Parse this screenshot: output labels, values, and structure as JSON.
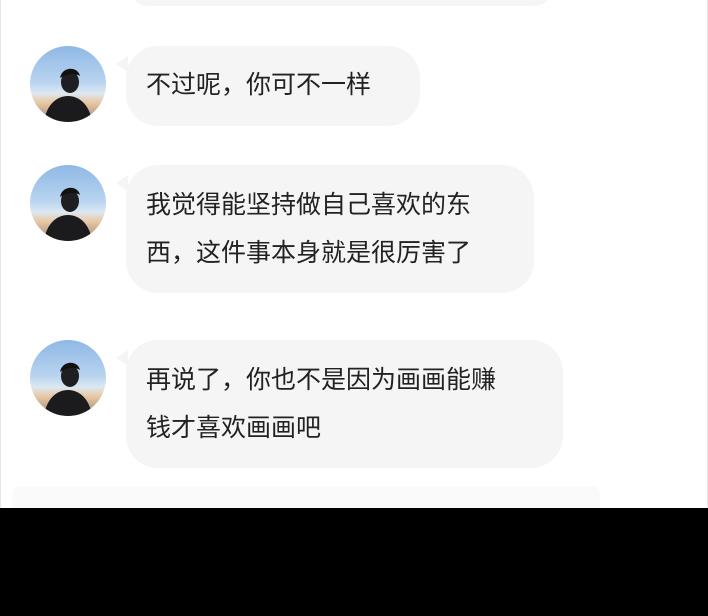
{
  "messages": [
    {
      "lines": [
        "不过呢，你可不一样"
      ]
    },
    {
      "lines": [
        "我觉得能坚持做自己喜欢的东",
        "西，这件事本身就是很厉害了"
      ]
    },
    {
      "lines": [
        "再说了，你也不是因为画画能赚",
        "钱才喜欢画画吧"
      ]
    }
  ]
}
